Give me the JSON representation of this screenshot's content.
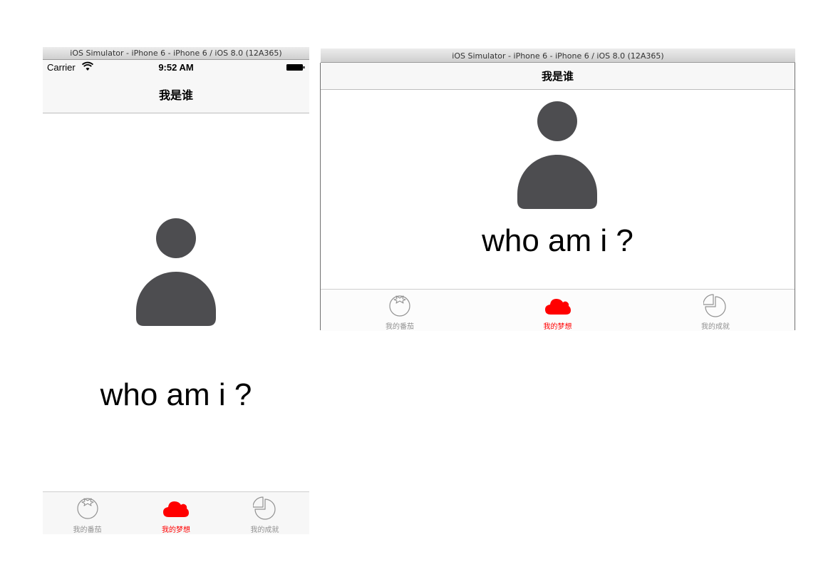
{
  "portrait": {
    "simulator_title": "iOS Simulator - iPhone 6 - iPhone 6 / iOS 8.0 (12A365)",
    "status": {
      "carrier": "Carrier",
      "time": "9:52 AM"
    },
    "nav_title": "我是谁",
    "main_text": "who am i ?",
    "tabs": [
      {
        "label": "我的番茄",
        "icon": "tomato-icon",
        "active": false
      },
      {
        "label": "我的梦想",
        "icon": "cloud-icon",
        "active": true
      },
      {
        "label": "我的成就",
        "icon": "pie-chart-icon",
        "active": false
      }
    ]
  },
  "landscape": {
    "simulator_title": "iOS Simulator - iPhone 6 - iPhone 6 / iOS 8.0 (12A365)",
    "nav_title": "我是谁",
    "main_text": "who am i ?",
    "tabs": [
      {
        "label": "我的番茄",
        "icon": "tomato-icon",
        "active": false
      },
      {
        "label": "我的梦想",
        "icon": "cloud-icon",
        "active": true
      },
      {
        "label": "我的成就",
        "icon": "pie-chart-icon",
        "active": false
      }
    ]
  },
  "colors": {
    "accent": "#ff0000",
    "icon_gray": "#929292",
    "person": "#4d4d50"
  }
}
